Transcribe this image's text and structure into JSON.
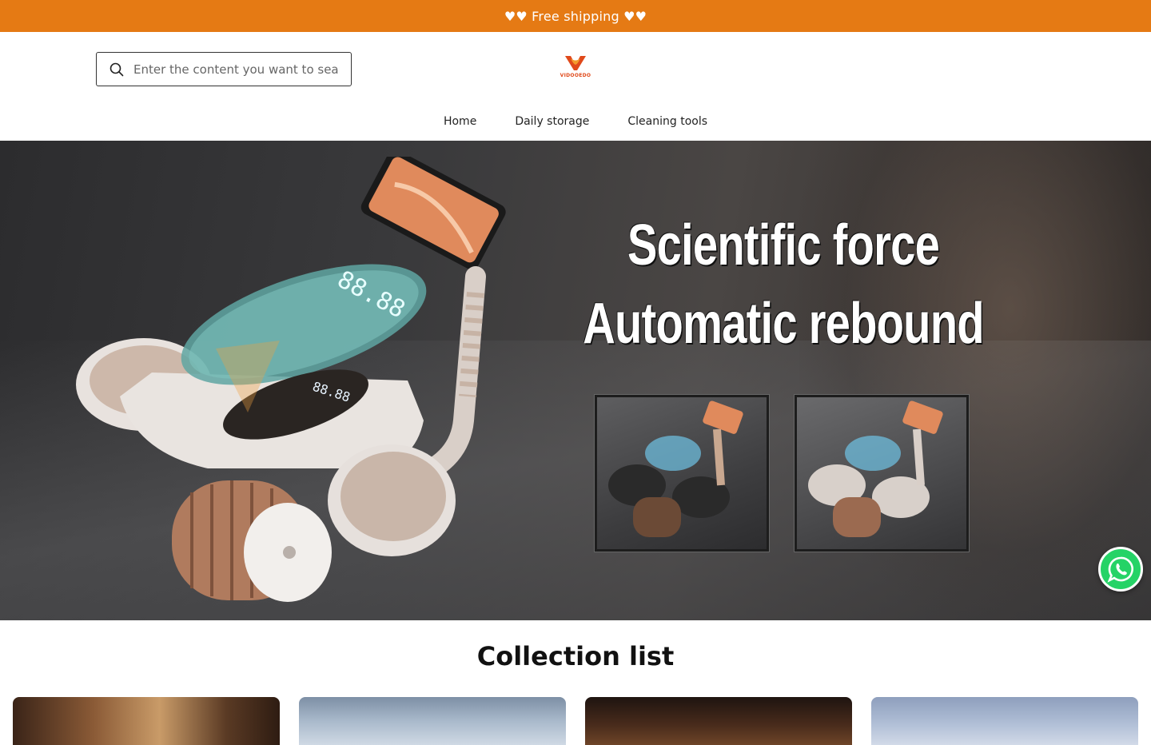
{
  "announcement": {
    "text": "♥♥ Free shipping ♥♥"
  },
  "header": {
    "search": {
      "placeholder": "Enter the content you want to search"
    },
    "logo": {
      "wordmark": "VIDOOEDO"
    }
  },
  "nav": {
    "items": [
      {
        "label": "Home"
      },
      {
        "label": "Daily storage"
      },
      {
        "label": "Cleaning tools"
      }
    ]
  },
  "hero": {
    "line1": "Scientific force",
    "line2": "Automatic rebound",
    "display_readout": "88.88"
  },
  "collection": {
    "title": "Collection list"
  },
  "colors": {
    "announcement_bg": "#e57a14",
    "logo_orange": "#e0491a",
    "whatsapp_green": "#25d366"
  }
}
